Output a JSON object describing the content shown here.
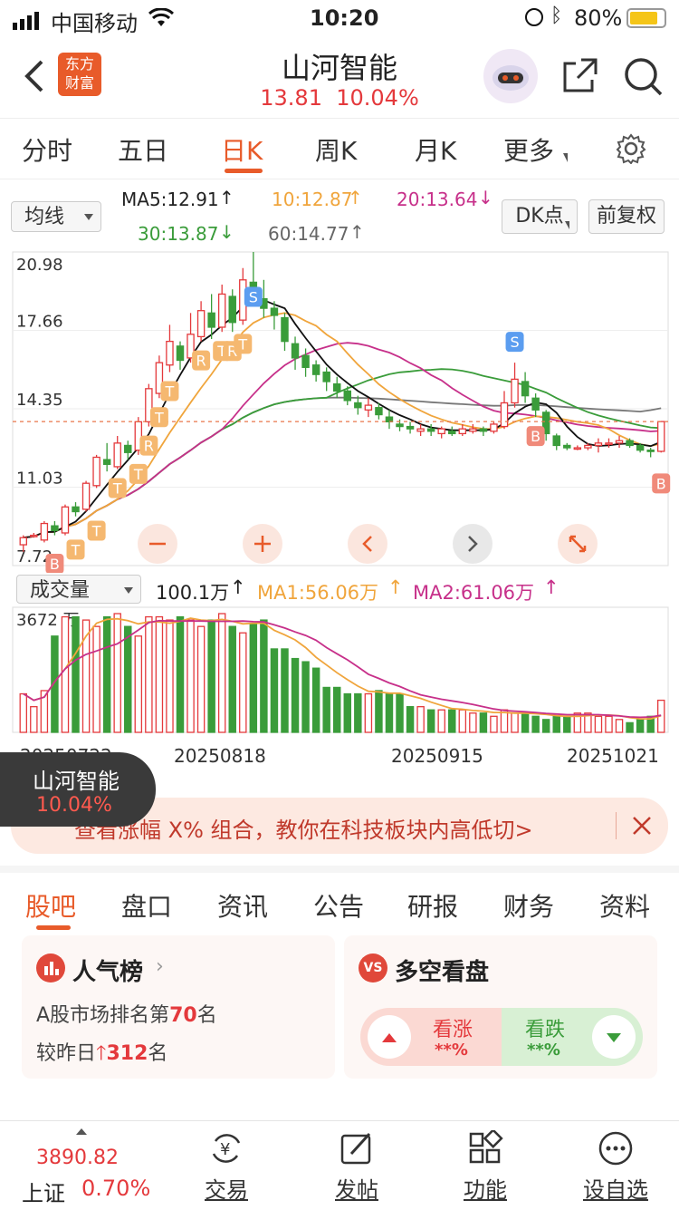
{
  "status_bar": {
    "carrier": "中国移动",
    "time": "10:20",
    "battery": "80%"
  },
  "header": {
    "logo_text_1": "东方",
    "logo_text_2": "财富",
    "title": "山河智能",
    "price": "13.81",
    "change_pct": "10.04%",
    "icons": [
      "back-icon",
      "robot-avatar-icon",
      "share-icon",
      "search-icon"
    ]
  },
  "period_tabs": [
    "分时",
    "五日",
    "日K",
    "周K",
    "月K",
    "更多"
  ],
  "active_tab": "日K",
  "ma": {
    "selector": "均线",
    "ma5": "MA5:12.91",
    "ma10": "10:12.87",
    "ma20": "20:13.64",
    "ma30": "30:13.87",
    "ma60": "60:14.77",
    "dk_button": "DK点",
    "adjust_button": "前复权"
  },
  "price_axis": [
    "20.98",
    "17.66",
    "14.35",
    "11.03",
    "7.72"
  ],
  "volume": {
    "selector": "成交量",
    "value": "100.1万",
    "ma1": "MA1:56.06万",
    "ma2": "MA2:61.06万",
    "axis_max": "3672 万"
  },
  "dates": [
    "20250722",
    "20250818",
    "20250915",
    "20251021"
  ],
  "chart_controls": [
    "zoom-out-icon",
    "zoom-in-icon",
    "pan-left-icon",
    "pan-right-icon",
    "fullscreen-icon"
  ],
  "chart_markers": {
    "buy": "B",
    "sell": "S",
    "t": "T",
    "r": "R"
  },
  "chart_data": {
    "type": "candlestick",
    "ylim": [
      7.72,
      20.98
    ],
    "candles": [
      [
        8.6,
        8.9,
        8.3,
        9.0
      ],
      [
        9.0,
        9.0,
        8.9,
        9.1
      ],
      [
        8.8,
        9.5,
        8.7,
        9.6
      ],
      [
        9.4,
        9.2,
        9.0,
        9.6
      ],
      [
        9.1,
        10.2,
        9.0,
        10.3
      ],
      [
        10.2,
        10.0,
        9.8,
        10.4
      ],
      [
        10.1,
        11.2,
        10.0,
        11.3
      ],
      [
        11.1,
        12.3,
        11.0,
        12.4
      ],
      [
        12.2,
        12.0,
        11.7,
        12.9
      ],
      [
        11.9,
        12.9,
        11.8,
        13.2
      ],
      [
        12.8,
        12.5,
        12.2,
        13.0
      ],
      [
        12.6,
        13.8,
        12.4,
        14.0
      ],
      [
        13.8,
        15.2,
        13.6,
        15.4
      ],
      [
        15.0,
        16.3,
        14.8,
        16.6
      ],
      [
        16.2,
        17.2,
        15.9,
        17.9
      ],
      [
        17.0,
        16.4,
        16.0,
        17.2
      ],
      [
        16.5,
        17.5,
        16.3,
        18.4
      ],
      [
        17.4,
        18.5,
        17.2,
        18.9
      ],
      [
        18.4,
        17.8,
        17.3,
        19.2
      ],
      [
        17.8,
        19.2,
        17.6,
        19.6
      ],
      [
        19.1,
        18.0,
        17.6,
        19.4
      ],
      [
        18.1,
        19.8,
        17.9,
        20.3
      ],
      [
        19.7,
        19.1,
        18.7,
        20.98
      ],
      [
        19.0,
        18.6,
        18.2,
        19.8
      ],
      [
        18.6,
        18.3,
        17.7,
        18.9
      ],
      [
        18.2,
        17.2,
        16.8,
        18.4
      ],
      [
        17.1,
        16.5,
        16.0,
        17.4
      ],
      [
        16.6,
        16.1,
        15.7,
        16.9
      ],
      [
        16.2,
        15.8,
        15.5,
        16.4
      ],
      [
        15.9,
        15.5,
        15.1,
        16.1
      ],
      [
        15.4,
        15.1,
        14.8,
        15.7
      ],
      [
        15.1,
        14.7,
        14.5,
        15.3
      ],
      [
        14.6,
        14.4,
        14.1,
        14.9
      ],
      [
        14.3,
        14.5,
        14.0,
        14.8
      ],
      [
        14.4,
        14.1,
        13.9,
        14.6
      ],
      [
        14.0,
        13.8,
        13.5,
        14.3
      ],
      [
        13.7,
        13.6,
        13.4,
        13.9
      ],
      [
        13.6,
        13.5,
        13.3,
        13.8
      ],
      [
        13.4,
        13.5,
        13.2,
        13.7
      ],
      [
        13.5,
        13.4,
        13.2,
        13.7
      ],
      [
        13.3,
        13.5,
        13.1,
        13.6
      ],
      [
        13.4,
        13.3,
        13.2,
        13.6
      ],
      [
        13.3,
        13.5,
        13.2,
        13.7
      ],
      [
        13.4,
        13.5,
        13.3,
        13.7
      ],
      [
        13.5,
        13.4,
        13.2,
        13.6
      ],
      [
        13.4,
        13.7,
        13.3,
        13.8
      ],
      [
        13.6,
        14.6,
        13.5,
        15.1
      ],
      [
        14.6,
        15.6,
        14.4,
        16.3
      ],
      [
        15.5,
        14.9,
        14.6,
        15.9
      ],
      [
        14.8,
        14.3,
        14.0,
        15.0
      ],
      [
        14.2,
        13.3,
        13.0,
        14.3
      ],
      [
        13.2,
        12.8,
        12.6,
        13.3
      ],
      [
        12.8,
        12.7,
        12.6,
        12.9
      ],
      [
        12.7,
        12.7,
        12.6,
        12.8
      ],
      [
        12.7,
        12.8,
        12.6,
        12.9
      ],
      [
        12.8,
        12.9,
        12.5,
        13.1
      ],
      [
        12.9,
        12.9,
        12.7,
        13.1
      ],
      [
        12.9,
        13.0,
        12.7,
        13.2
      ],
      [
        13.0,
        12.8,
        12.7,
        13.1
      ],
      [
        12.8,
        12.6,
        12.5,
        12.9
      ],
      [
        12.6,
        12.55,
        12.3,
        12.7
      ],
      [
        12.55,
        13.81,
        12.5,
        13.81
      ]
    ],
    "volume_values": [
      12,
      8,
      13,
      30,
      36,
      36,
      35,
      33,
      36,
      37,
      33,
      30,
      36,
      36,
      35,
      36,
      35,
      33,
      35,
      37,
      33,
      31,
      34,
      35,
      26,
      26,
      23,
      22,
      20,
      14,
      14,
      12,
      12,
      12,
      13,
      12,
      12,
      8,
      8,
      7,
      7,
      7,
      7,
      6,
      6,
      5,
      7,
      6,
      6,
      5,
      4,
      5,
      5,
      6,
      6,
      5,
      5,
      4,
      3,
      4,
      5,
      10
    ],
    "volume_ylim": [
      0,
      36.72
    ]
  },
  "popup": {
    "name": "山河智能",
    "pct": "10.04%"
  },
  "banner": {
    "text": "查看涨幅 X% 组合，教你在科技板块内高低切>"
  },
  "section_tabs": [
    "股吧",
    "盘口",
    "资讯",
    "公告",
    "研报",
    "财务",
    "资料"
  ],
  "active_section": "股吧",
  "popularity": {
    "title": "人气榜",
    "rank_prefix": "A股市场排名第",
    "rank": "70",
    "rank_suffix": "名",
    "change_prefix": "较昨日",
    "change": "312",
    "change_suffix": "名"
  },
  "long_short": {
    "title": "多空看盘",
    "bull": "看涨",
    "bull_val": "**%",
    "bear": "看跌",
    "bear_val": "**%"
  },
  "bottom_bar": {
    "index_value": "3890.82",
    "index_name": "上证",
    "index_pct": "0.70%",
    "items": [
      "交易",
      "发帖",
      "功能",
      "设自选"
    ]
  }
}
